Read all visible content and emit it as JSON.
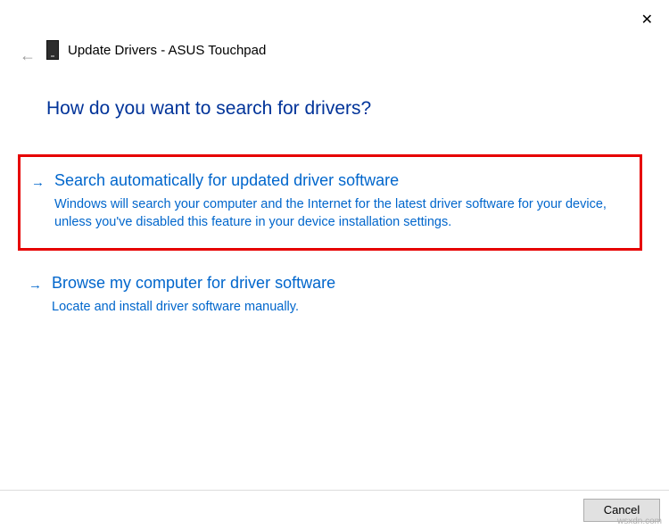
{
  "window": {
    "title": "Update Drivers - ASUS Touchpad"
  },
  "heading": "How do you want to search for drivers?",
  "options": [
    {
      "title": "Search automatically for updated driver software",
      "description": "Windows will search your computer and the Internet for the latest driver software for your device, unless you've disabled this feature in your device installation settings."
    },
    {
      "title": "Browse my computer for driver software",
      "description": "Locate and install driver software manually."
    }
  ],
  "buttons": {
    "cancel": "Cancel"
  },
  "watermark": "wsxdn.com"
}
